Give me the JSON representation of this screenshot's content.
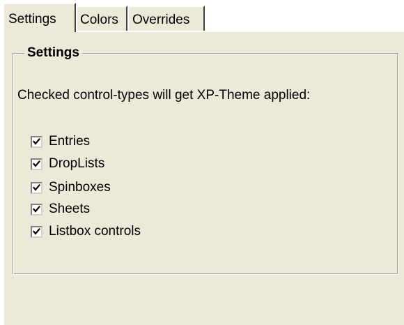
{
  "tabs": [
    {
      "label": "Settings",
      "active": true
    },
    {
      "label": "Colors",
      "active": false
    },
    {
      "label": "Overrides",
      "active": false
    }
  ],
  "group": {
    "title": "Settings",
    "description": "Checked control-types will get XP-Theme applied:"
  },
  "checkboxes": [
    {
      "label": "Entries",
      "checked": true
    },
    {
      "label": "DropLists",
      "checked": true
    },
    {
      "label": "Spinboxes",
      "checked": true
    },
    {
      "label": "Sheets",
      "checked": true
    },
    {
      "label": "Listbox controls",
      "checked": true
    }
  ],
  "colors": {
    "face": "#ece9d8",
    "highlight": "#ffffff",
    "shadow": "#808080",
    "dark_shadow": "#404040"
  },
  "icons": {
    "check": "checkmark-icon"
  }
}
